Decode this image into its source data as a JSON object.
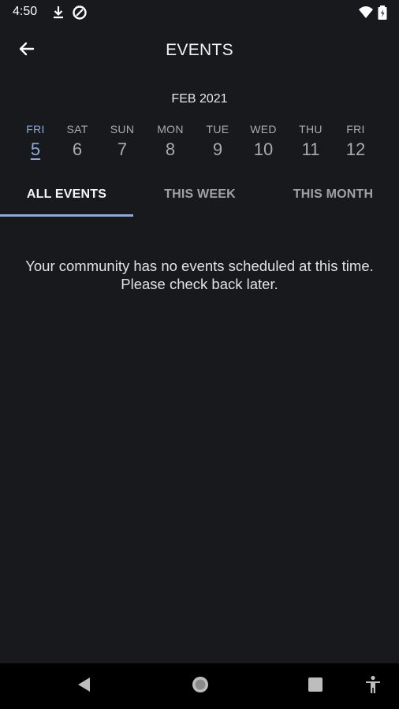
{
  "status_bar": {
    "time": "4:50",
    "icons": [
      "download-icon",
      "data-saver-icon",
      "wifi-icon",
      "battery-icon"
    ]
  },
  "app_bar": {
    "title": "EVENTS",
    "back_icon": "arrow-left-icon"
  },
  "calendar": {
    "month": "FEB 2021",
    "days": [
      {
        "name": "FRI",
        "num": "5",
        "selected": true
      },
      {
        "name": "SAT",
        "num": "6"
      },
      {
        "name": "SUN",
        "num": "7"
      },
      {
        "name": "MON",
        "num": "8"
      },
      {
        "name": "TUE",
        "num": "9"
      },
      {
        "name": "WED",
        "num": "10"
      },
      {
        "name": "THU",
        "num": "11"
      },
      {
        "name": "FRI",
        "num": "12"
      }
    ]
  },
  "tabs": [
    {
      "label": "ALL EVENTS",
      "active": true
    },
    {
      "label": "THIS WEEK"
    },
    {
      "label": "THIS MONTH"
    }
  ],
  "empty_message": "Your community has no events scheduled at this time. Please check back later.",
  "nav_bar": {
    "icons": [
      "back-triangle-icon",
      "home-circle-icon",
      "recents-square-icon",
      "accessibility-icon"
    ]
  },
  "colors": {
    "background": "#17191c",
    "accent": "#8fa9d8",
    "nav_background": "#000000"
  }
}
